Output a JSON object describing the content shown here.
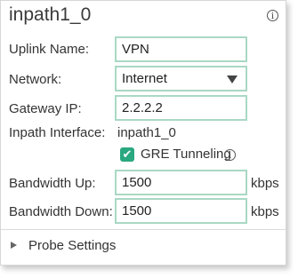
{
  "panel": {
    "title": "inpath1_0",
    "info_icon": "i"
  },
  "fields": {
    "uplink_name": {
      "label": "Uplink Name:",
      "value": "VPN"
    },
    "network": {
      "label": "Network:",
      "value": "Internet"
    },
    "gateway_ip": {
      "label": "Gateway IP:",
      "value": "2.2.2.2"
    },
    "inpath_interface": {
      "label": "Inpath Interface:",
      "value": "inpath1_0"
    },
    "gre_tunneling": {
      "label": "GRE Tunneling",
      "checked": true,
      "check_glyph": "✔",
      "info_icon": "i"
    },
    "bandwidth_up": {
      "label": "Bandwidth Up:",
      "value": "1500",
      "unit": "kbps"
    },
    "bandwidth_down": {
      "label": "Bandwidth Down:",
      "value": "1500",
      "unit": "kbps"
    }
  },
  "probe_settings": {
    "label": "Probe Settings",
    "icon": "caret-right-icon"
  },
  "colors": {
    "field_border": "#a9d8c4",
    "checkbox_fill": "#2aa87f",
    "panel_border": "#d6d6d6"
  }
}
